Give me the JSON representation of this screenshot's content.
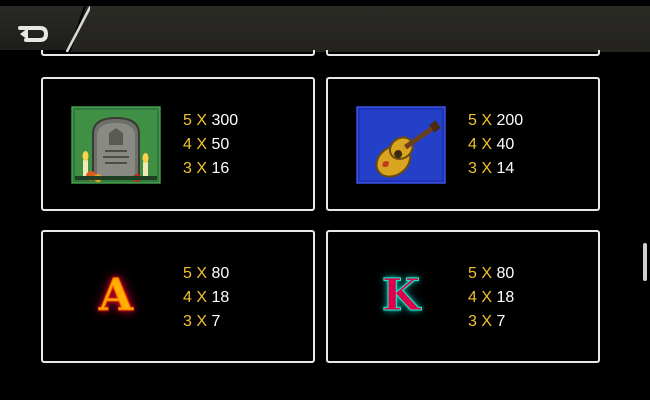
{
  "header": {
    "back_icon": "back-arrow-icon"
  },
  "paytable": [
    {
      "symbol": "tombstone",
      "payouts": [
        {
          "count": "5",
          "x": "X",
          "value": "300"
        },
        {
          "count": "4",
          "x": "X",
          "value": "50"
        },
        {
          "count": "3",
          "x": "X",
          "value": "16"
        }
      ]
    },
    {
      "symbol": "guitar",
      "payouts": [
        {
          "count": "5",
          "x": "X",
          "value": "200"
        },
        {
          "count": "4",
          "x": "X",
          "value": "40"
        },
        {
          "count": "3",
          "x": "X",
          "value": "14"
        }
      ]
    },
    {
      "symbol": "letter-a",
      "glyph": "A",
      "payouts": [
        {
          "count": "5",
          "x": "X",
          "value": "80"
        },
        {
          "count": "4",
          "x": "X",
          "value": "18"
        },
        {
          "count": "3",
          "x": "X",
          "value": "7"
        }
      ]
    },
    {
      "symbol": "letter-k",
      "glyph": "K",
      "payouts": [
        {
          "count": "5",
          "x": "X",
          "value": "80"
        },
        {
          "count": "4",
          "x": "X",
          "value": "18"
        },
        {
          "count": "3",
          "x": "X",
          "value": "7"
        }
      ]
    }
  ],
  "colors": {
    "multiplier": "#f2c12e",
    "value": "#ffffff",
    "card_border": "#e8e8e8",
    "background": "#000000"
  }
}
